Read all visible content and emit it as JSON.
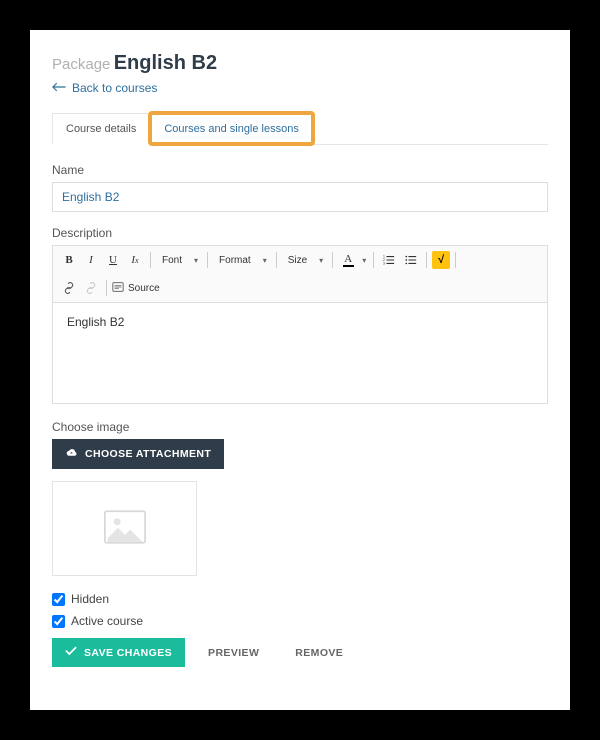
{
  "header": {
    "package_label": "Package",
    "title": "English B2",
    "back_link": "Back to courses"
  },
  "tabs": {
    "details": "Course details",
    "courses": "Courses and single lessons"
  },
  "form": {
    "name_label": "Name",
    "name_value": "English B2",
    "description_label": "Description",
    "description_value": "English B2",
    "image_label": "Choose image",
    "choose_attachment": "CHOOSE ATTACHMENT",
    "hidden_label": "Hidden",
    "hidden_checked": true,
    "active_label": "Active course",
    "active_checked": true
  },
  "editor_toolbar": {
    "bold": "B",
    "italic": "I",
    "underline": "U",
    "remove_format": "Ix",
    "font": "Font",
    "format": "Format",
    "size": "Size",
    "text_color": "A",
    "math": "√",
    "source": "Source"
  },
  "actions": {
    "save": "SAVE CHANGES",
    "preview": "PREVIEW",
    "remove": "REMOVE"
  }
}
